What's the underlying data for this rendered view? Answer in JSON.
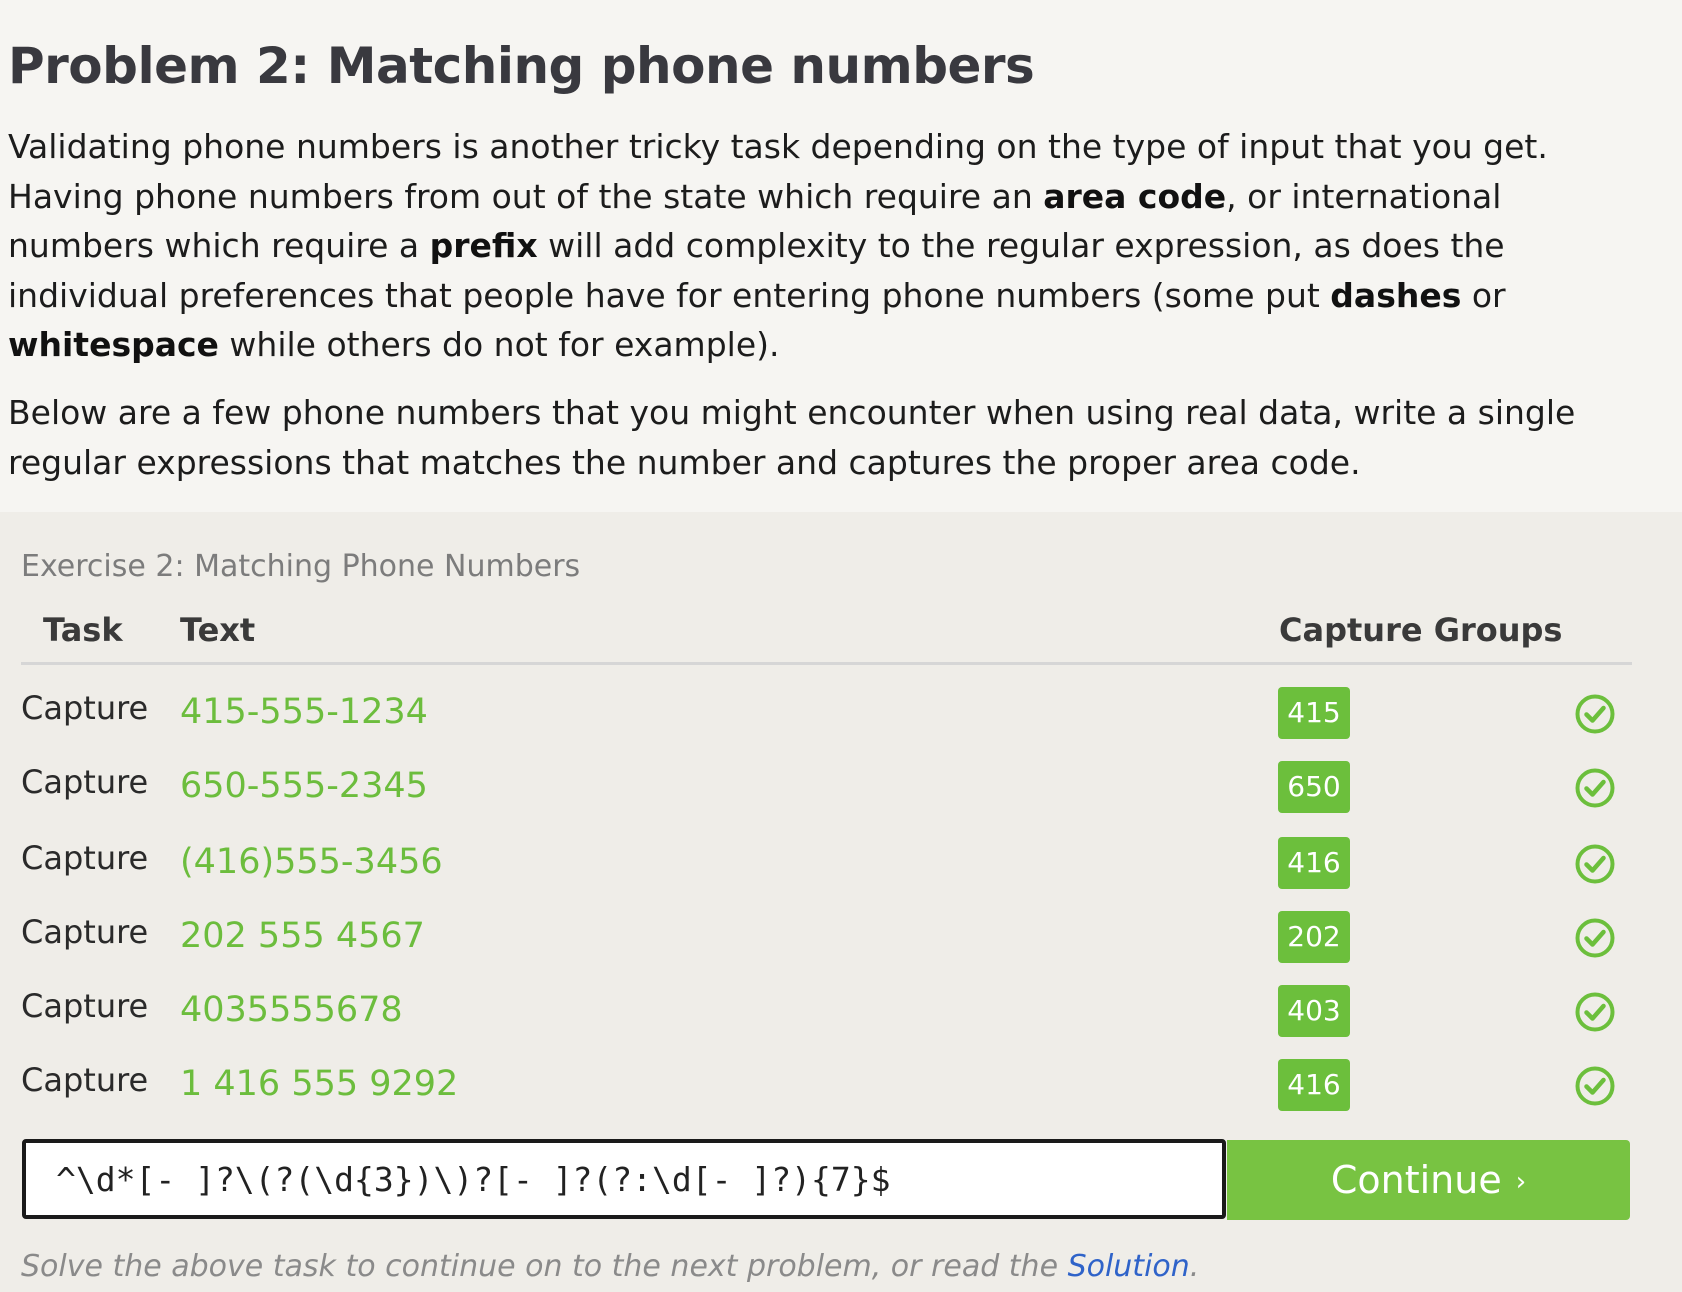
{
  "problem": {
    "title": "Problem 2: Matching phone numbers",
    "para1": {
      "t1": "Validating phone numbers is another tricky task depending on the type of input that you get. Having phone numbers from out of the state which require an ",
      "b1": "area code",
      "t2": ", or international numbers which require a ",
      "b2": "prefix",
      "t3": " will add complexity to the regular expression, as does the individual preferences that people have for entering phone numbers (some put ",
      "b3": "dashes",
      "t4": " or ",
      "b4": "whitespace",
      "t5": " while others do not for example)."
    },
    "para2": "Below are a few phone numbers that you might encounter when using real data, write a single regular expressions that matches the number and captures the proper area code."
  },
  "exercise": {
    "title": "Exercise 2: Matching Phone Numbers",
    "headers": {
      "task": "Task",
      "text": "Text",
      "groups": "Capture Groups"
    },
    "rows": [
      {
        "task": "Capture",
        "text": "415-555-1234",
        "group": "415",
        "status": "check-circle-icon"
      },
      {
        "task": "Capture",
        "text": "650-555-2345",
        "group": "650",
        "status": "check-circle-icon"
      },
      {
        "task": "Capture",
        "text": "(416)555-3456",
        "group": "416",
        "status": "check-circle-icon"
      },
      {
        "task": "Capture",
        "text": "202 555 4567",
        "group": "202",
        "status": "check-circle-icon"
      },
      {
        "task": "Capture",
        "text": "4035555678",
        "group": "403",
        "status": "check-circle-icon"
      },
      {
        "task": "Capture",
        "text": "1 416 555 9292",
        "group": "416",
        "status": "check-circle-icon"
      }
    ],
    "regex_value": "^\\d*[- ]?\\(?(\\d{3})\\)?[- ]?(?:\\d[- ]?){7}$",
    "continue_label": "Continue",
    "continue_chevron": "›",
    "footer": {
      "before": "Solve the above task to continue on to the next problem, or read the ",
      "link": "Solution",
      "after": "."
    },
    "colors": {
      "match_text": "#6cbd3d",
      "badge": "#6cbf3c",
      "continue": "#78c342",
      "link": "#2f63c9"
    }
  }
}
